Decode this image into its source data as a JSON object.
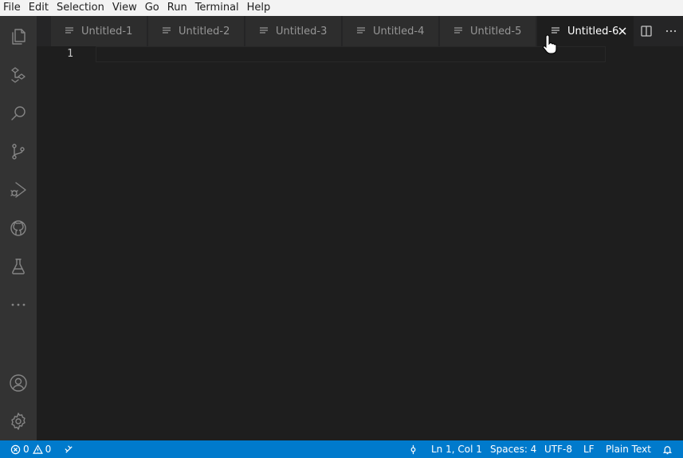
{
  "menu": [
    "File",
    "Edit",
    "Selection",
    "View",
    "Go",
    "Run",
    "Terminal",
    "Help"
  ],
  "activity_bar": {
    "items": [
      {
        "icon": "files-icon"
      },
      {
        "icon": "remote-explorer-icon"
      },
      {
        "icon": "search-icon"
      },
      {
        "icon": "source-control-icon"
      },
      {
        "icon": "run-debug-icon"
      },
      {
        "icon": "github-icon"
      },
      {
        "icon": "testing-icon"
      },
      {
        "icon": "more-icon"
      }
    ],
    "bottom": [
      {
        "icon": "account-icon"
      },
      {
        "icon": "settings-gear-icon"
      }
    ]
  },
  "tabs": [
    {
      "label": "Untitled-1",
      "active": false
    },
    {
      "label": "Untitled-2",
      "active": false
    },
    {
      "label": "Untitled-3",
      "active": false
    },
    {
      "label": "Untitled-4",
      "active": false
    },
    {
      "label": "Untitled-5",
      "active": false
    },
    {
      "label": "Untitled-6",
      "active": true
    }
  ],
  "editor": {
    "line_numbers": [
      "1"
    ]
  },
  "status_bar": {
    "errors": "0",
    "warnings": "0",
    "position": "Ln 1, Col 1",
    "spaces": "Spaces: 4",
    "encoding": "UTF-8",
    "eol": "LF",
    "language": "Plain Text"
  },
  "colors": {
    "accent": "#007acc",
    "activity_bar": "#333333",
    "editor_bg": "#1e1e1e",
    "tab_inactive": "#2d2d2d"
  }
}
